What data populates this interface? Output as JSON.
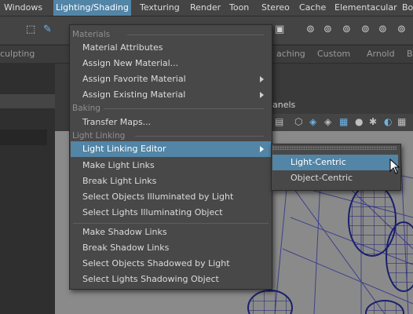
{
  "menubar": {
    "items": [
      "Windows",
      "Lighting/Shading",
      "Texturing",
      "Render",
      "Toon",
      "Stereo",
      "Cache",
      "Elementacular",
      "Bo"
    ],
    "active_index": 1
  },
  "shelf": {
    "tabs": [
      "culpting",
      "aching",
      "Custom",
      "Arnold",
      "B"
    ]
  },
  "panels": {
    "label": "anels"
  },
  "menu": {
    "sections": {
      "materials": "Materials",
      "baking": "Baking",
      "light_linking": "Light Linking"
    },
    "items": {
      "material_attributes": "Material Attributes",
      "assign_new_material": "Assign New Material...",
      "assign_favorite_material": "Assign Favorite Material",
      "assign_existing_material": "Assign Existing Material",
      "transfer_maps": "Transfer Maps...",
      "light_linking_editor": "Light Linking Editor",
      "make_light_links": "Make Light Links",
      "break_light_links": "Break Light Links",
      "select_objects_illuminated": "Select Objects Illuminated by Light",
      "select_lights_illuminating": "Select Lights Illuminating Object",
      "make_shadow_links": "Make Shadow Links",
      "break_shadow_links": "Break Shadow Links",
      "select_objects_shadowed": "Select Objects Shadowed by Light",
      "select_lights_shadowing": "Select Lights Shadowing Object"
    }
  },
  "submenu": {
    "items": [
      "Light-Centric",
      "Object-Centric"
    ],
    "highlighted_index": 0
  },
  "colors": {
    "highlight": "#5285a6",
    "menu_bg": "#484848",
    "wireframe": "#1a1f6e"
  },
  "icons": [
    "select-tool-icon",
    "paint-tool-icon",
    "shelf-tool-icons",
    "panel-toolbar-icons",
    "submenu-arrow-icon",
    "mouse-cursor-icon"
  ]
}
